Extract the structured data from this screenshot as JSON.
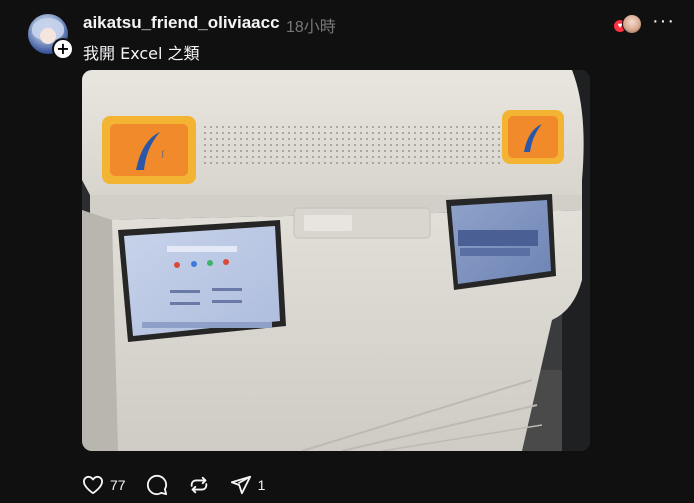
{
  "post": {
    "username": "aikatsu_friend_oliviaacc",
    "timestamp": "18小時",
    "caption": "我開 Excel 之類",
    "follow_symbol": "+",
    "more_symbol": "···"
  },
  "photo": {
    "subject": "kiosk-with-screens"
  },
  "actions": {
    "like_count": "77",
    "comment_count": "",
    "repost_count": "",
    "share_count": "1"
  },
  "icons": {
    "like": "heart-icon",
    "comment": "comment-icon",
    "repost": "repost-icon",
    "share": "send-icon"
  },
  "colors": {
    "background": "#101010",
    "text": "#f3f5f7",
    "muted": "#777777",
    "heart": "#ff3040"
  }
}
